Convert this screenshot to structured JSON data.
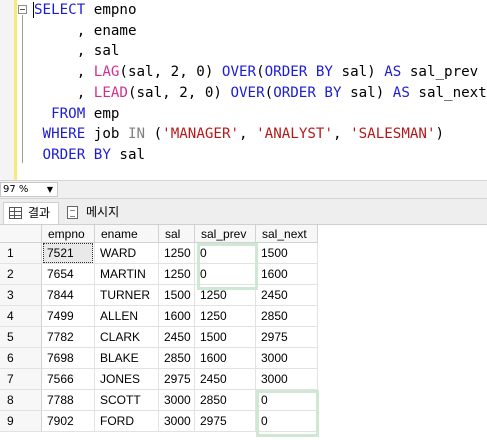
{
  "editor": {
    "lines": [
      [
        {
          "t": "SELECT",
          "c": "kw"
        },
        {
          "t": " empno",
          "c": ""
        }
      ],
      [
        {
          "t": "     , ename",
          "c": ""
        }
      ],
      [
        {
          "t": "     , sal",
          "c": ""
        }
      ],
      [
        {
          "t": "     , ",
          "c": ""
        },
        {
          "t": "LAG",
          "c": "fn"
        },
        {
          "t": "(sal, 2, 0) ",
          "c": ""
        },
        {
          "t": "OVER",
          "c": "kw"
        },
        {
          "t": "(",
          "c": ""
        },
        {
          "t": "ORDER BY",
          "c": "kw"
        },
        {
          "t": " sal) ",
          "c": ""
        },
        {
          "t": "AS",
          "c": "kw"
        },
        {
          "t": " sal_prev",
          "c": ""
        }
      ],
      [
        {
          "t": "     , ",
          "c": ""
        },
        {
          "t": "LEAD",
          "c": "fn"
        },
        {
          "t": "(sal, 2, 0) ",
          "c": ""
        },
        {
          "t": "OVER",
          "c": "kw"
        },
        {
          "t": "(",
          "c": ""
        },
        {
          "t": "ORDER BY",
          "c": "kw"
        },
        {
          "t": " sal) ",
          "c": ""
        },
        {
          "t": "AS",
          "c": "kw"
        },
        {
          "t": " sal_next",
          "c": ""
        }
      ],
      [
        {
          "t": "  FROM",
          "c": "kw"
        },
        {
          "t": " emp",
          "c": ""
        }
      ],
      [
        {
          "t": " WHERE",
          "c": "kw"
        },
        {
          "t": " job ",
          "c": ""
        },
        {
          "t": "IN",
          "c": "gr"
        },
        {
          "t": " (",
          "c": ""
        },
        {
          "t": "'MANAGER'",
          "c": "st"
        },
        {
          "t": ", ",
          "c": ""
        },
        {
          "t": "'ANALYST'",
          "c": "st"
        },
        {
          "t": ", ",
          "c": ""
        },
        {
          "t": "'SALESMAN'",
          "c": "st"
        },
        {
          "t": ")",
          "c": ""
        }
      ],
      [
        {
          "t": " ORDER BY",
          "c": "kw"
        },
        {
          "t": " sal",
          "c": ""
        }
      ]
    ]
  },
  "zoom": {
    "value": "97 %"
  },
  "tabs": {
    "results": "결과",
    "messages": "메시지"
  },
  "grid": {
    "columns": [
      "empno",
      "ename",
      "sal",
      "sal_prev",
      "sal_next"
    ],
    "rows": [
      {
        "num": "1",
        "empno": "7521",
        "ename": "WARD",
        "sal": "1250",
        "sal_prev": "0",
        "sal_next": "1500"
      },
      {
        "num": "2",
        "empno": "7654",
        "ename": "MARTIN",
        "sal": "1250",
        "sal_prev": "0",
        "sal_next": "1600"
      },
      {
        "num": "3",
        "empno": "7844",
        "ename": "TURNER",
        "sal": "1500",
        "sal_prev": "1250",
        "sal_next": "2450"
      },
      {
        "num": "4",
        "empno": "7499",
        "ename": "ALLEN",
        "sal": "1600",
        "sal_prev": "1250",
        "sal_next": "2850"
      },
      {
        "num": "5",
        "empno": "7782",
        "ename": "CLARK",
        "sal": "2450",
        "sal_prev": "1500",
        "sal_next": "2975"
      },
      {
        "num": "6",
        "empno": "7698",
        "ename": "BLAKE",
        "sal": "2850",
        "sal_prev": "1600",
        "sal_next": "3000"
      },
      {
        "num": "7",
        "empno": "7566",
        "ename": "JONES",
        "sal": "2975",
        "sal_prev": "2450",
        "sal_next": "3000"
      },
      {
        "num": "8",
        "empno": "7788",
        "ename": "SCOTT",
        "sal": "3000",
        "sal_prev": "2850",
        "sal_next": "0"
      },
      {
        "num": "9",
        "empno": "7902",
        "ename": "FORD",
        "sal": "3000",
        "sal_prev": "2975",
        "sal_next": "0"
      }
    ]
  },
  "colors": {
    "keyword": "#1c1cd6",
    "function": "#d3308d",
    "string": "#b51a1a",
    "highlight_box": "#cfe8d4",
    "changebar": "#f5ea7a"
  }
}
